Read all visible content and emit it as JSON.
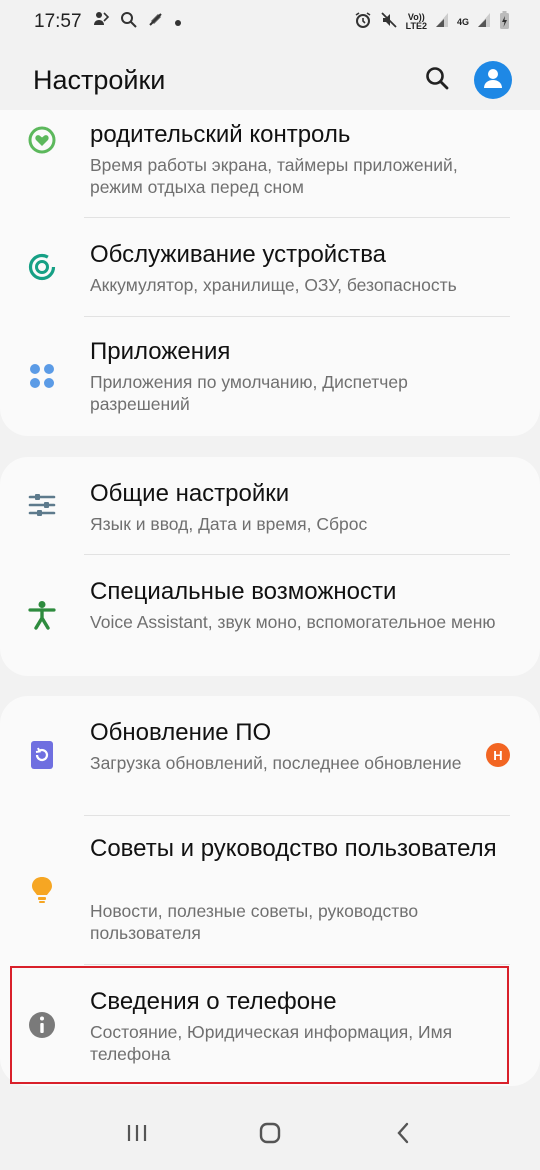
{
  "status_bar": {
    "time": "17:57",
    "volte_label": "Vo))\nLTE2",
    "network_label": "4G",
    "icons": [
      "dual-user-icon",
      "search-status-icon",
      "location-off-icon",
      "dot-icon",
      "alarm-icon",
      "mute-icon",
      "volte-icon",
      "signal-icon",
      "network-4g-icon",
      "signal-icon",
      "battery-charging-icon"
    ]
  },
  "app_bar": {
    "title": "Настройки",
    "search_icon": "search-icon",
    "avatar_icon": "account-icon",
    "accent": "#1e88e5"
  },
  "groups": [
    {
      "items": [
        {
          "title": "родительский контроль",
          "subtitle": "Время работы экрана, таймеры приложений, режим отдыха перед сном",
          "icon": "parental-control-icon",
          "icon_color": "#5cb85c"
        },
        {
          "title": "Обслуживание устройства",
          "subtitle": "Аккумулятор, хранилище, ОЗУ, безопасность",
          "icon": "device-care-icon",
          "icon_color": "#16a085"
        },
        {
          "title": "Приложения",
          "subtitle": "Приложения по умолчанию, Диспетчер разрешений",
          "icon": "apps-icon",
          "icon_color": "#5b9be6"
        }
      ]
    },
    {
      "items": [
        {
          "title": "Общие настройки",
          "subtitle": "Язык и ввод, Дата и время, Сброс",
          "icon": "general-management-icon",
          "icon_color": "#5d7a8c"
        },
        {
          "title": "Специальные возможности",
          "subtitle": "Voice Assistant, звук моно, вспомогательное меню",
          "icon": "accessibility-icon",
          "icon_color": "#2e8b3e"
        }
      ]
    },
    {
      "items": [
        {
          "title": "Обновление ПО",
          "subtitle": "Загрузка обновлений, последнее обновление",
          "icon": "software-update-icon",
          "icon_color": "#6f6fe0",
          "badge": "Н",
          "badge_color": "#f26522"
        },
        {
          "title": "Советы и руководство пользователя",
          "subtitle": "Новости, полезные советы, руководство пользователя",
          "icon": "tips-lightbulb-icon",
          "icon_color": "#f6a623"
        },
        {
          "title": "Сведения о телефоне",
          "subtitle": "Состояние, Юридическая информация, Имя телефона",
          "icon": "info-icon",
          "icon_color": "#7a7a7a",
          "highlighted": true,
          "highlight_color": "#d9202a"
        }
      ]
    }
  ],
  "nav_bar": {
    "icons": [
      "recent-apps-icon",
      "home-icon",
      "back-icon"
    ]
  }
}
